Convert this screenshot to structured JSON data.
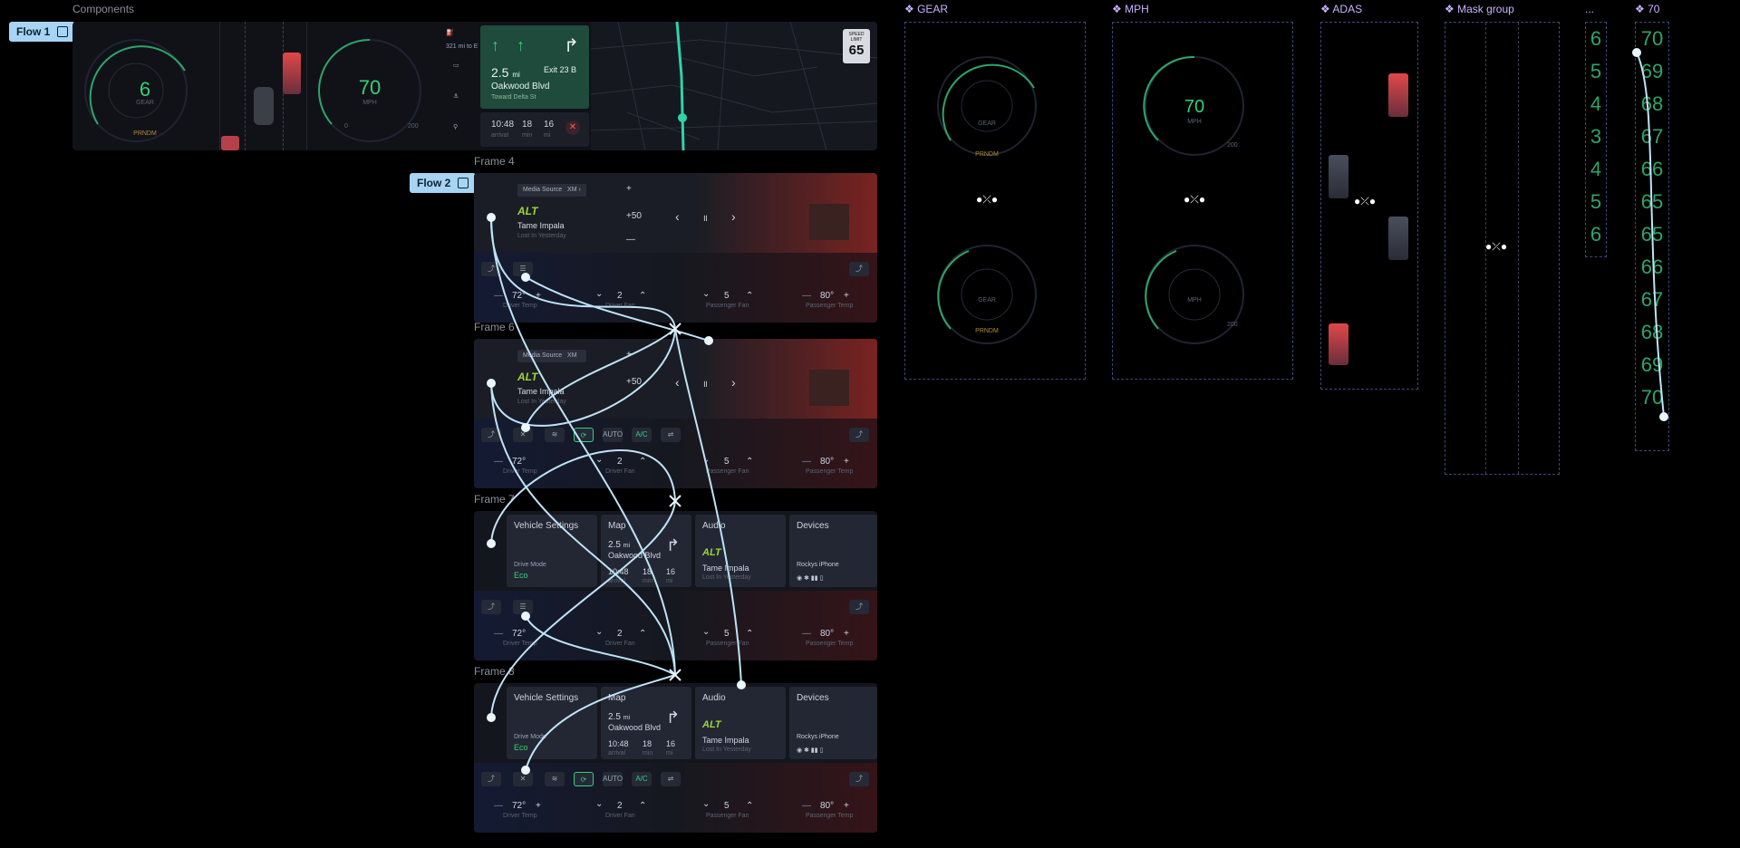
{
  "labels": {
    "components": "Components",
    "frame4": "Frame 4",
    "frame6": "Frame 6",
    "frame7": "Frame 7",
    "frame8": "Frame 8"
  },
  "flows": {
    "flow1": "Flow 1",
    "flow2": "Flow 2"
  },
  "component_sets": {
    "gear": "❖ GEAR",
    "mph": "❖ MPH",
    "adas": "❖ ADAS",
    "mask": "❖ Mask group",
    "ellipsis": "...",
    "seventy": "❖ 70"
  },
  "cluster": {
    "gear_value": "6",
    "gear_label": "GEAR",
    "gear_modes": "PRNDM",
    "speed_value": "70",
    "speed_label": "MPH",
    "range": "321 mi to E",
    "tick_low": "0",
    "tick_high": "200",
    "nav_distance": "2.5",
    "nav_unit": "mi",
    "nav_exit": "Exit 23 B",
    "nav_street": "Oakwood Blvd",
    "nav_toward": "Toward Delta St",
    "arrival_time": "10:48",
    "arrival_label": "arrival",
    "mins": "18",
    "mins_label": "min",
    "miles": "16",
    "miles_label": "mi",
    "speed_limit_label": "SPEED LIMIT",
    "speed_limit": "65",
    "map_pin": "A"
  },
  "media": {
    "source": "Media Source",
    "source_value": "XM",
    "station": "ALT",
    "artist": "Tame Impala",
    "song": "Lost In Yesterday",
    "volume": "+50",
    "plus": "+",
    "minus": "—",
    "prev": "‹",
    "pause": "॥",
    "next": "›"
  },
  "climate": {
    "driver_temp": "72°",
    "driver_temp_label": "Driver Temp",
    "driver_fan": "2",
    "driver_fan_label": "Driver Fan",
    "pass_fan": "5",
    "pass_fan_label": "Passenger Fan",
    "pass_temp": "80°",
    "pass_temp_label": "Passenger Temp",
    "minus": "—",
    "plus": "+",
    "down": "⌄",
    "up": "⌃",
    "auto": "AUTO",
    "ac": "A/C"
  },
  "home": {
    "vehicle_settings": "Vehicle Settings",
    "drive_mode_label": "Drive Mode",
    "drive_mode": "Eco",
    "map": "Map",
    "map_distance": "2.5",
    "map_unit": "mi",
    "map_street": "Oakwood Blvd",
    "map_time": "10:48",
    "map_time_label": "arrival",
    "map_mins": "18",
    "map_mins_label": "min",
    "map_miles": "16",
    "map_miles_label": "mi",
    "audio": "Audio",
    "devices": "Devices",
    "device_name": "Rockys iPhone"
  },
  "gear_digits": [
    "6",
    "5",
    "4",
    "3",
    "4",
    "5",
    "6"
  ],
  "speed_digits": [
    "70",
    "69",
    "68",
    "67",
    "66",
    "65",
    "65",
    "66",
    "67",
    "68",
    "69",
    "70"
  ],
  "colors": {
    "accent_green": "#34d07a",
    "flow_blue": "#a7d4f2",
    "component_purple": "#c9b3ff",
    "alert_red": "#ff5a5a"
  }
}
